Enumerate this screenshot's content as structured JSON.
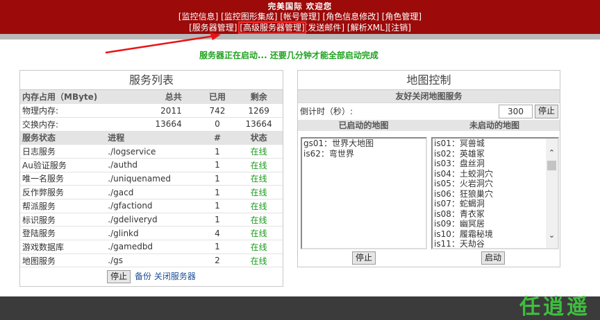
{
  "header": {
    "welcome": "完美国际 欢迎您",
    "nav_row1": [
      "[监控信息]",
      "[监控图形集成]",
      "[帐号管理]",
      "[角色信息修改]",
      "[角色管理]"
    ],
    "nav_row2": [
      "[服务器管理]",
      "[高级服务器管理]",
      "[发送邮件]",
      "[解析XML]",
      "[注销]"
    ]
  },
  "status_message": "服务器正在启动... 还要几分钟才能全部启动完成",
  "services_panel": {
    "title": "服务列表",
    "memory_header": [
      "内存占用（MByte)",
      "总共",
      "已用",
      "剩余"
    ],
    "memory_rows": [
      {
        "name": "物理内存:",
        "total": "2011",
        "used": "742",
        "free": "1269"
      },
      {
        "name": "交换内存:",
        "total": "13664",
        "used": "0",
        "free": "13664"
      }
    ],
    "service_header": [
      "服务状态",
      "进程",
      "#",
      "状态"
    ],
    "services": [
      {
        "name": "日志服务",
        "process": "./logservice",
        "count": "1",
        "status": "在线"
      },
      {
        "name": "Au验证服务",
        "process": "./authd",
        "count": "1",
        "status": "在线"
      },
      {
        "name": "唯一名服务",
        "process": "./uniquenamed",
        "count": "1",
        "status": "在线"
      },
      {
        "name": "反作弊服务",
        "process": "./gacd",
        "count": "1",
        "status": "在线"
      },
      {
        "name": "帮派服务",
        "process": "./gfactiond",
        "count": "1",
        "status": "在线"
      },
      {
        "name": "标识服务",
        "process": "./gdeliveryd",
        "count": "1",
        "status": "在线"
      },
      {
        "name": "登陆服务",
        "process": "./glinkd",
        "count": "4",
        "status": "在线"
      },
      {
        "name": "游戏数据库",
        "process": "./gamedbd",
        "count": "1",
        "status": "在线"
      },
      {
        "name": "地图服务",
        "process": "./gs",
        "count": "2",
        "status": "在线"
      }
    ],
    "stop_button": "停止",
    "backup_link": "备份 关闭服务器"
  },
  "map_panel": {
    "title": "地图控制",
    "subtitle": "友好关闭地图服务",
    "countdown_label": "倒计时（秒）:",
    "countdown_value": "300",
    "countdown_stop": "停止",
    "started_header": "已启动的地图",
    "not_started_header": "未启动的地图",
    "started_maps": [
      "gs01：世界大地图",
      "is62：弯世界"
    ],
    "not_started_maps": [
      "is01：冥兽城",
      "is02：英雄冢",
      "is03：盘丝洞",
      "is04：土蛟洞穴",
      "is05：火岩洞穴",
      "is06：狂狼巢穴",
      "is07：蛇蝎洞",
      "is08：青衣冢",
      "is09：幽冥居",
      "is10：履霜秘境",
      "is11：天劫谷"
    ],
    "stop_button": "停止",
    "start_button": "启动"
  },
  "brand_text": "任逍遥",
  "colors": {
    "header_bg": "#9c0a0a",
    "status_green": "#1ea21e",
    "online_green": "#1a9a1a",
    "arrow_red": "#e81414"
  }
}
